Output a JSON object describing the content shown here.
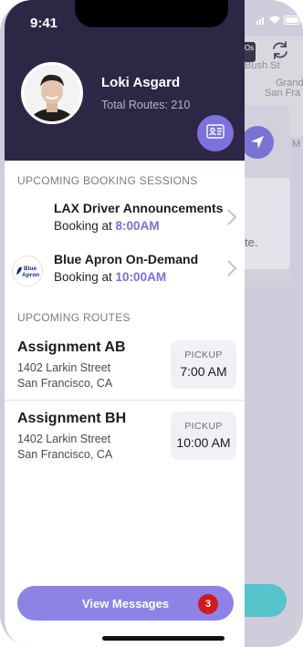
{
  "status_bar": {
    "time": "9:41"
  },
  "background": {
    "streets": [
      "Bush St",
      "Grand",
      "San Fra",
      "M"
    ],
    "snippet": "te.",
    "pin_label": "Os"
  },
  "profile": {
    "name": "Loki Asgard",
    "total_routes": "Total Routes: 210"
  },
  "booking": {
    "section_title": "UPCOMING BOOKING SESSIONS",
    "items": [
      {
        "title": "LAX Driver Announcements",
        "prefix": "Booking at ",
        "time": "8:00AM",
        "logo": ""
      },
      {
        "title": "Blue Apron On-Demand",
        "prefix": "Booking at ",
        "time": "10:00AM",
        "logo": "Blue Apron"
      }
    ]
  },
  "routes": {
    "section_title": "UPCOMING ROUTES",
    "items": [
      {
        "title": "Assignment AB",
        "address1": "1402 Larkin Street",
        "address2": "San Francisco, CA",
        "pickup_label": "PICKUP",
        "pickup_time": "7:00 AM"
      },
      {
        "title": "Assignment BH",
        "address1": "1402 Larkin Street",
        "address2": "San Francisco, CA",
        "pickup_label": "PICKUP",
        "pickup_time": "10:00 AM"
      }
    ]
  },
  "messages": {
    "label": "View Messages",
    "count": "3"
  },
  "colors": {
    "header": "#2d2745",
    "accent": "#7d72dc",
    "badge": "#d11a1a",
    "teal": "#55c5cb"
  }
}
